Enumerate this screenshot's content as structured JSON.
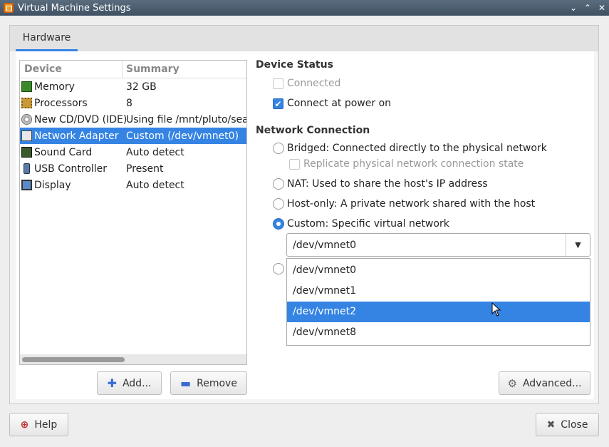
{
  "window": {
    "title": "Virtual Machine Settings",
    "controls": {
      "minimize": "⌄",
      "maximize": "⌃",
      "close": "✕"
    }
  },
  "tabs": [
    {
      "label": "Hardware",
      "active": true
    }
  ],
  "device_list": {
    "headers": {
      "device": "Device",
      "summary": "Summary"
    },
    "rows": [
      {
        "icon": "memory-icon",
        "device": "Memory",
        "summary": "32 GB"
      },
      {
        "icon": "processor-icon",
        "device": "Processors",
        "summary": "8"
      },
      {
        "icon": "cd-dvd-icon",
        "device": "New CD/DVD (IDE)",
        "summary": "Using file /mnt/pluto/seaga"
      },
      {
        "icon": "network-adapter-icon",
        "device": "Network Adapter",
        "summary": "Custom (/dev/vmnet0)",
        "selected": true
      },
      {
        "icon": "sound-card-icon",
        "device": "Sound Card",
        "summary": "Auto detect"
      },
      {
        "icon": "usb-controller-icon",
        "device": "USB Controller",
        "summary": "Present"
      },
      {
        "icon": "display-icon",
        "device": "Display",
        "summary": "Auto detect"
      }
    ],
    "scrollbar_position": 0
  },
  "buttons": {
    "add": "Add...",
    "remove": "Remove",
    "advanced": "Advanced...",
    "help": "Help",
    "close": "Close"
  },
  "device_status": {
    "title": "Device Status",
    "connected": {
      "label": "Connected",
      "checked": false,
      "enabled": false
    },
    "connect_power_on": {
      "label": "Connect at power on",
      "checked": true
    }
  },
  "network_connection": {
    "title": "Network Connection",
    "bridged": {
      "label": "Bridged: Connected directly to the physical network",
      "selected": false
    },
    "replicate": {
      "label": "Replicate physical network connection state",
      "checked": false,
      "enabled": false
    },
    "nat": {
      "label": "NAT: Used to share the host's IP address",
      "selected": false
    },
    "host_only": {
      "label": "Host-only: A private network shared with the host",
      "selected": false
    },
    "custom": {
      "label": "Custom: Specific virtual network",
      "selected": true
    },
    "custom_value": "/dev/vmnet0",
    "dropdown_options": [
      "/dev/vmnet0",
      "/dev/vmnet1",
      "/dev/vmnet2",
      "/dev/vmnet8"
    ],
    "highlighted_option": "/dev/vmnet2"
  },
  "colors": {
    "accent": "#3584e4",
    "titlebar": "#4a5d70"
  }
}
